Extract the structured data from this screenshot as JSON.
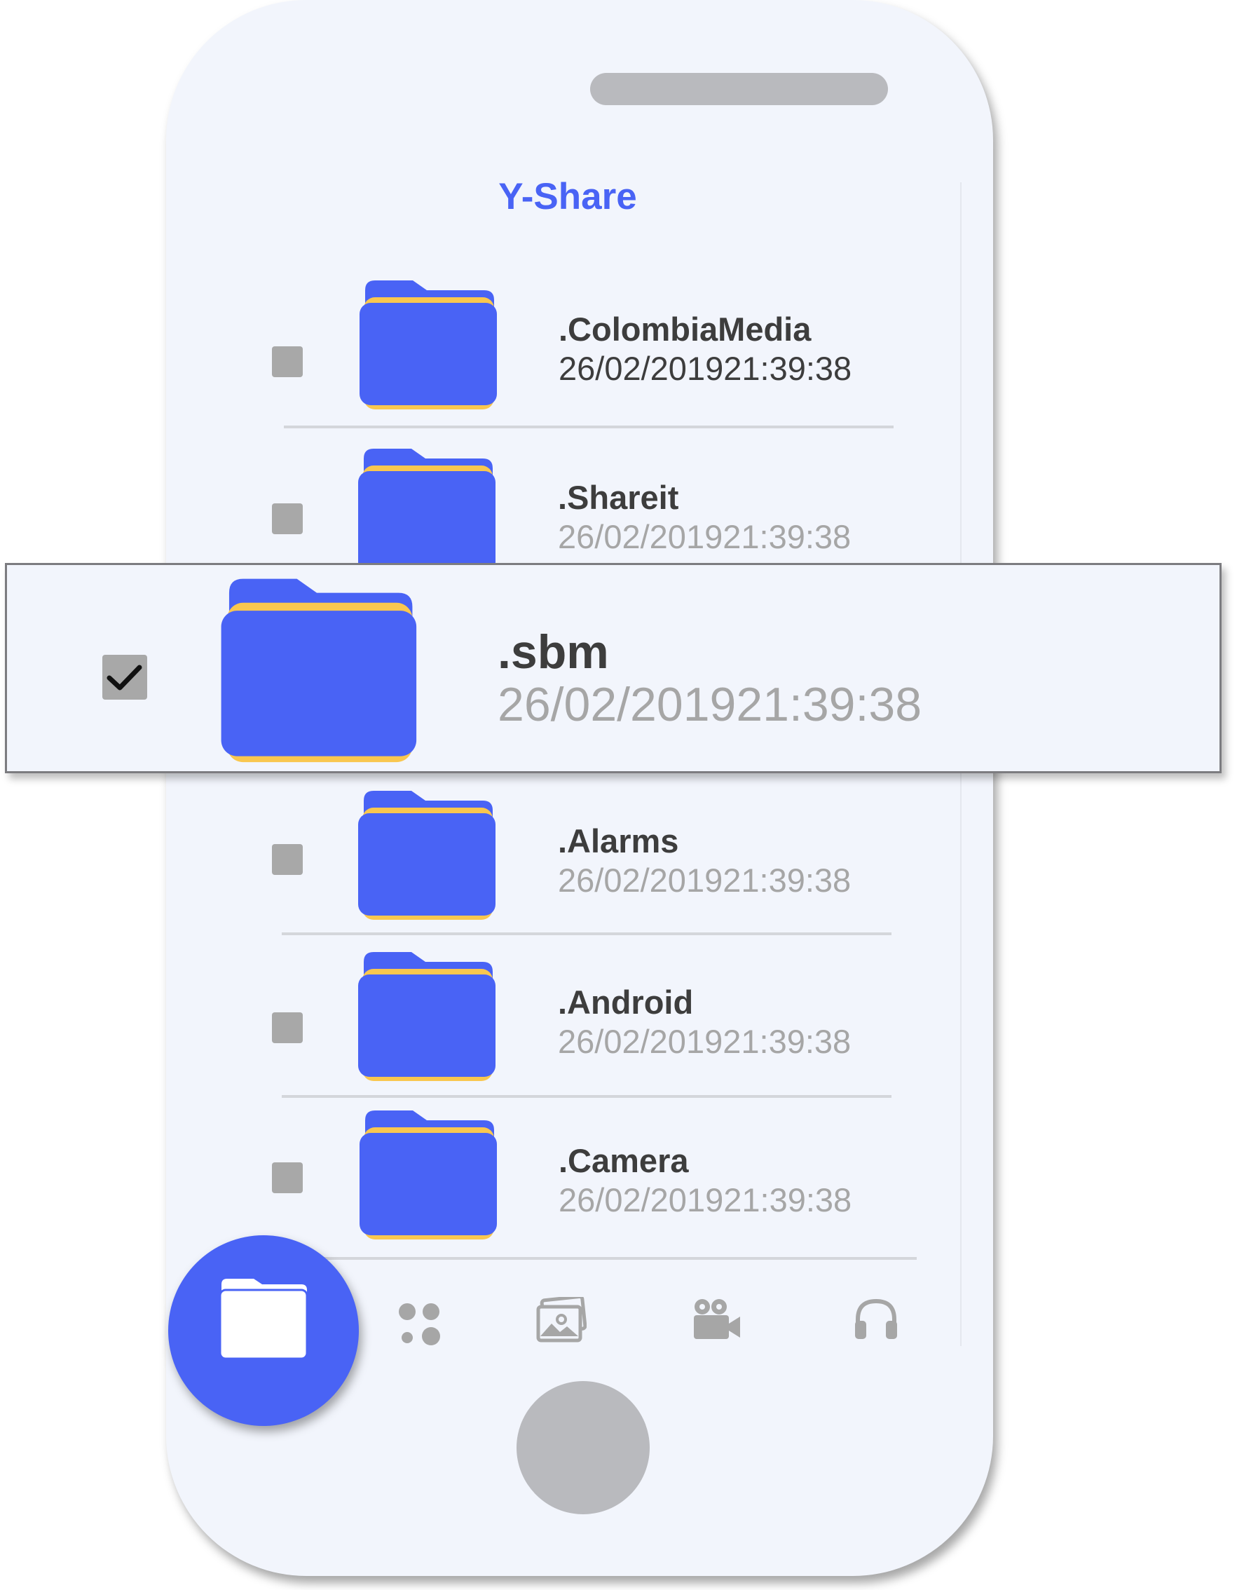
{
  "app": {
    "title": "Y-Share",
    "accent_color": "#4963f5",
    "folder_color": "#4963f5",
    "folder_edge_color": "#f9c74f"
  },
  "folders": [
    {
      "name": ".ColombiaMedia",
      "date": "26/02/201921:39:38",
      "checked": false
    },
    {
      "name": ".Shareit",
      "date": "26/02/201921:39:38",
      "checked": false
    },
    {
      "name": ".sbm",
      "date": "26/02/201921:39:38",
      "checked": true
    },
    {
      "name": ".Alarms",
      "date": "26/02/201921:39:38",
      "checked": false
    },
    {
      "name": ".Android",
      "date": "26/02/201921:39:38",
      "checked": false
    },
    {
      "name": ".Camera",
      "date": "26/02/201921:39:38",
      "checked": false
    }
  ],
  "bottom_nav": [
    {
      "icon": "folder-icon",
      "active": true
    },
    {
      "icon": "apps-icon",
      "active": false
    },
    {
      "icon": "photos-icon",
      "active": false
    },
    {
      "icon": "video-camera-icon",
      "active": false
    },
    {
      "icon": "headphones-icon",
      "active": false
    }
  ]
}
